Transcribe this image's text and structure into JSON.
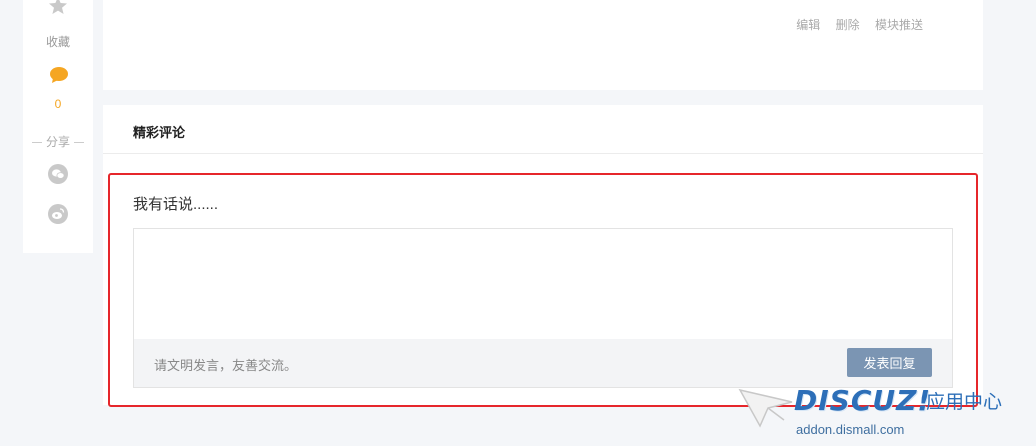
{
  "sidebar": {
    "favorite_label": "收藏",
    "comment_count": "0",
    "share_label": "分享",
    "icons": [
      "star-icon",
      "comment-icon",
      "wechat-icon",
      "weibo-icon"
    ],
    "accent_color": "#f5a623"
  },
  "top_card": {
    "actions": [
      "编辑",
      "删除",
      "模块推送"
    ]
  },
  "comments": {
    "title": "精彩评论",
    "prompt": "我有话说......",
    "input_placeholder": "",
    "hint": "请文明发言，友善交流。",
    "submit_label": "发表回复",
    "submit_color": "#7b95b3",
    "highlight_color": "#e6262b"
  },
  "watermark": {
    "logo": "DISCUZ!",
    "cn": "应用中心",
    "url": "addon.dismall.com"
  }
}
